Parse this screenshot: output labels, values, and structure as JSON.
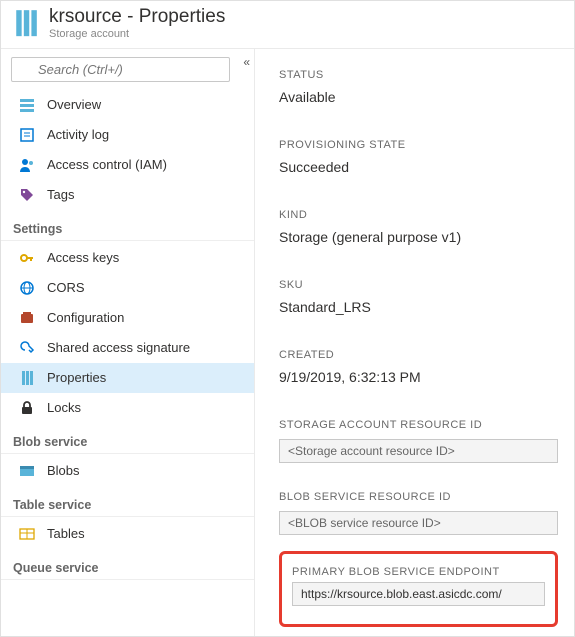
{
  "header": {
    "title": "krsource - Properties",
    "subtitle": "Storage account"
  },
  "search": {
    "placeholder": "Search (Ctrl+/)"
  },
  "nav": {
    "top": [
      {
        "label": "Overview",
        "icon": "overview"
      },
      {
        "label": "Activity log",
        "icon": "activity"
      },
      {
        "label": "Access control (IAM)",
        "icon": "iam"
      },
      {
        "label": "Tags",
        "icon": "tags"
      }
    ],
    "sections": [
      {
        "title": "Settings",
        "items": [
          {
            "label": "Access keys",
            "icon": "key"
          },
          {
            "label": "CORS",
            "icon": "cors"
          },
          {
            "label": "Configuration",
            "icon": "config"
          },
          {
            "label": "Shared access signature",
            "icon": "sas"
          },
          {
            "label": "Properties",
            "icon": "properties",
            "selected": true
          },
          {
            "label": "Locks",
            "icon": "lock"
          }
        ]
      },
      {
        "title": "Blob service",
        "items": [
          {
            "label": "Blobs",
            "icon": "blob"
          }
        ]
      },
      {
        "title": "Table service",
        "items": [
          {
            "label": "Tables",
            "icon": "table"
          }
        ]
      },
      {
        "title": "Queue service",
        "items": []
      }
    ]
  },
  "props": {
    "status_label": "STATUS",
    "status_value": "Available",
    "provstate_label": "PROVISIONING STATE",
    "provstate_value": "Succeeded",
    "kind_label": "KIND",
    "kind_value": "Storage (general purpose v1)",
    "sku_label": "SKU",
    "sku_value": "Standard_LRS",
    "created_label": "CREATED",
    "created_value": "9/19/2019, 6:32:13 PM",
    "resid_label": "STORAGE ACCOUNT RESOURCE ID",
    "resid_value": "<Storage account resource ID>",
    "blobres_label": "BLOB SERVICE RESOURCE ID",
    "blobres_value": "<BLOB service resource ID>",
    "endpoint_label": "PRIMARY BLOB SERVICE ENDPOINT",
    "endpoint_value": "https://krsource.blob.east.asicdc.com/"
  }
}
